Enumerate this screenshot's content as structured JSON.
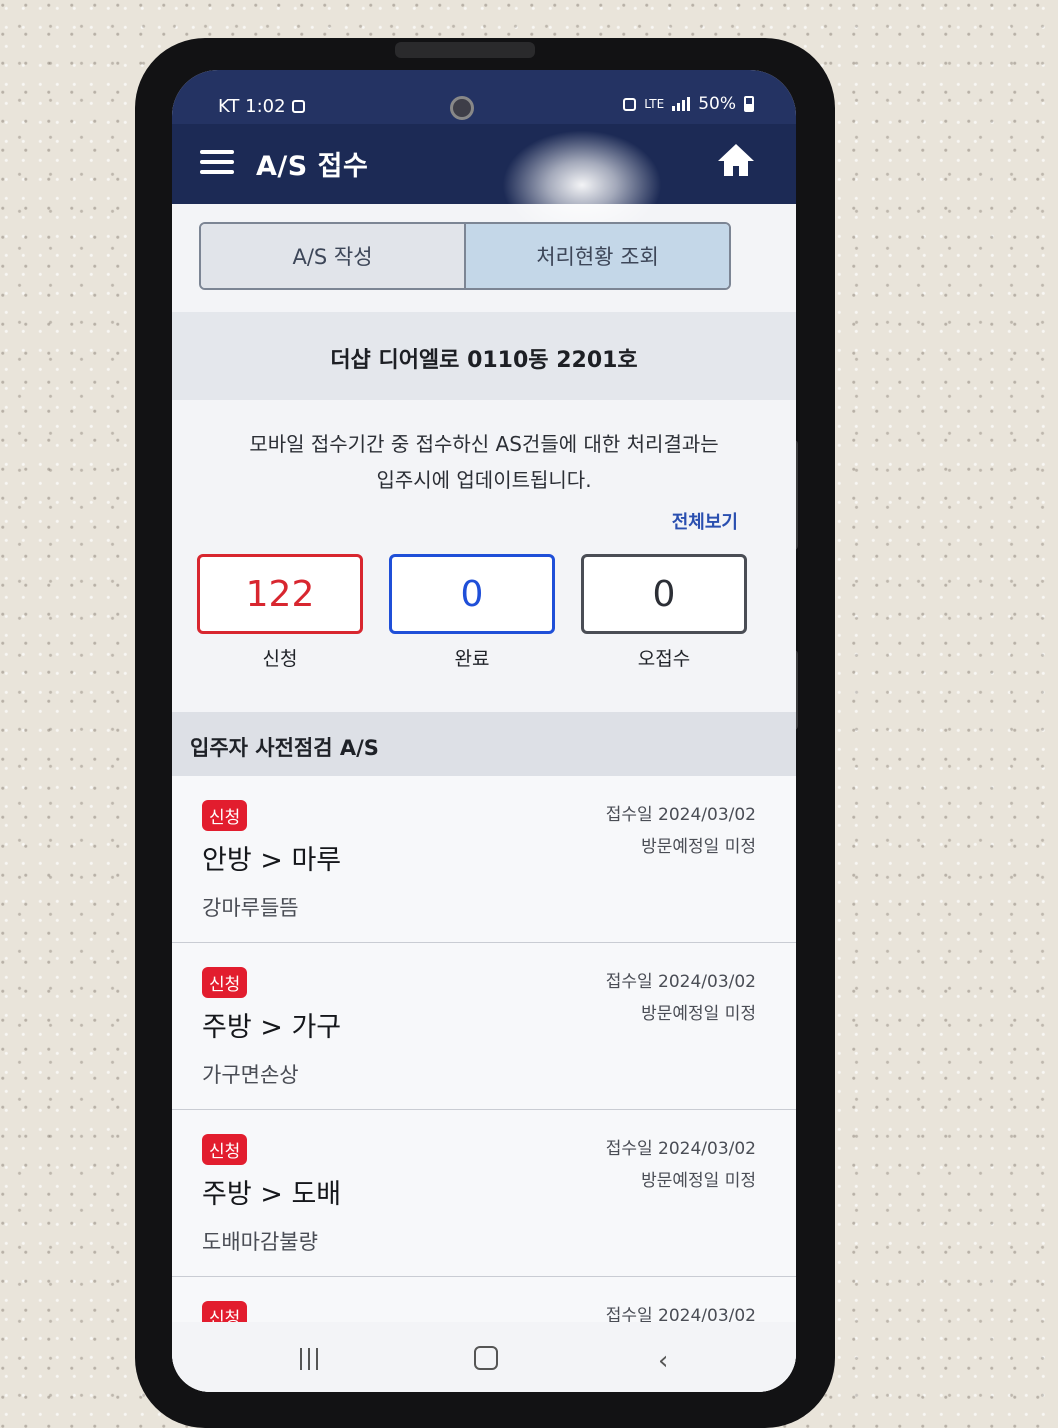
{
  "status_bar": {
    "carrier_time": "KT 1:02",
    "network": "LTE",
    "battery": "50%"
  },
  "app_bar": {
    "title": "A/S 접수"
  },
  "tabs": [
    {
      "label": "A/S 작성"
    },
    {
      "label": "처리현황 조회"
    }
  ],
  "unit": "더샵 디어엘로 0110동 2201호",
  "notice": {
    "line1": "모바일 접수기간 중 접수하신 AS건들에 대한 처리결과는",
    "line2": "입주시에 업데이트됩니다."
  },
  "view_all": "전체보기",
  "counts": [
    {
      "value": "122",
      "label": "신청",
      "color": "#d8262f"
    },
    {
      "value": "0",
      "label": "완료",
      "color": "#1f4fd8"
    },
    {
      "value": "0",
      "label": "오접수",
      "color": "#4a4d55"
    }
  ],
  "section_title": "입주자 사전점검 A/S",
  "items": [
    {
      "badge": "신청",
      "title": "안방 > 마루",
      "desc": "강마루들뜸",
      "date": "접수일 2024/03/02",
      "visit": "방문예정일 미정"
    },
    {
      "badge": "신청",
      "title": "주방 > 가구",
      "desc": "가구면손상",
      "date": "접수일 2024/03/02",
      "visit": "방문예정일 미정"
    },
    {
      "badge": "신청",
      "title": "주방 > 도배",
      "desc": "도배마감불량",
      "date": "접수일 2024/03/02",
      "visit": "방문예정일 미정"
    },
    {
      "badge": "신청",
      "title": "",
      "desc": "",
      "date": "접수일 2024/03/02",
      "visit": ""
    }
  ],
  "nav": {
    "back_icon": "‹"
  },
  "colors": {
    "app_bar": "#1c2a55",
    "badge": "#e21d2e",
    "accent_blue": "#2a4fb0"
  }
}
